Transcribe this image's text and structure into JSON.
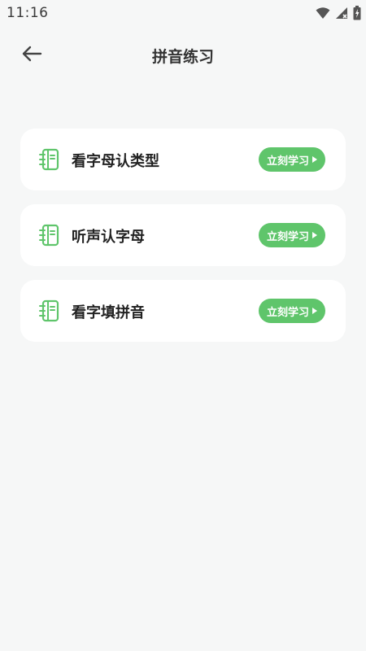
{
  "status_bar": {
    "time": "11:16",
    "icons": [
      "wifi-icon",
      "signal-icon",
      "battery-icon"
    ]
  },
  "header": {
    "back_icon": "arrow-left-icon",
    "title": "拼音练习"
  },
  "practice_items": [
    {
      "label": "看字母认类型",
      "button_label": "立刻学习",
      "icon": "notebook-icon"
    },
    {
      "label": "听声认字母",
      "button_label": "立刻学习",
      "icon": "notebook-icon"
    },
    {
      "label": "看字填拼音",
      "button_label": "立刻学习",
      "icon": "notebook-icon"
    }
  ],
  "colors": {
    "accent": "#5fc56b",
    "background": "#f6f7f7",
    "card": "#ffffff"
  }
}
